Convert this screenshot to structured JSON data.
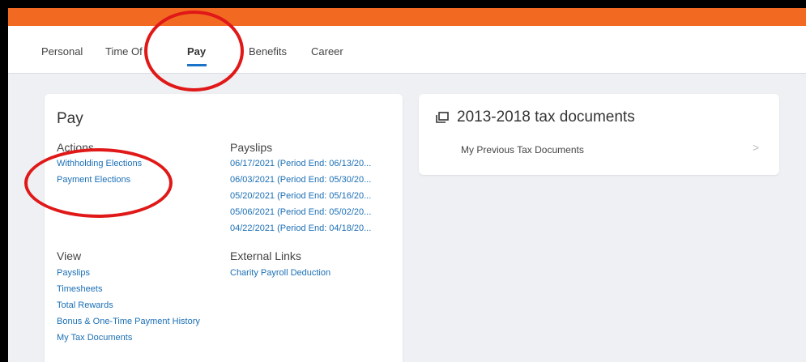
{
  "tabs": [
    {
      "label": "Personal"
    },
    {
      "label": "Time Of"
    },
    {
      "label": "Pay"
    },
    {
      "label": "Benefits"
    },
    {
      "label": "Career"
    }
  ],
  "pay_card": {
    "title": "Pay",
    "actions_title": "Actions",
    "actions": [
      "Withholding Elections",
      "Payment Elections"
    ],
    "payslips_title": "Payslips",
    "payslips": [
      "06/17/2021 (Period End: 06/13/20...",
      "06/03/2021 (Period End: 05/30/20...",
      "05/20/2021 (Period End: 05/16/20...",
      "05/06/2021 (Period End: 05/02/20...",
      "04/22/2021 (Period End: 04/18/20..."
    ],
    "view_title": "View",
    "view_links": [
      "Payslips",
      "Timesheets",
      "Total Rewards",
      "Bonus & One-Time Payment History",
      "My Tax Documents"
    ],
    "external_title": "External Links",
    "external_links": [
      "Charity Payroll Deduction"
    ]
  },
  "tax_card": {
    "title": "2013-2018 tax documents",
    "item": "My Previous Tax Documents",
    "chevron": ">"
  },
  "colors": {
    "accent": "#f26a21",
    "link": "#1b6fb5",
    "highlight": "#e01818"
  },
  "icons": [
    "documents-icon",
    "chevron-right-icon"
  ]
}
